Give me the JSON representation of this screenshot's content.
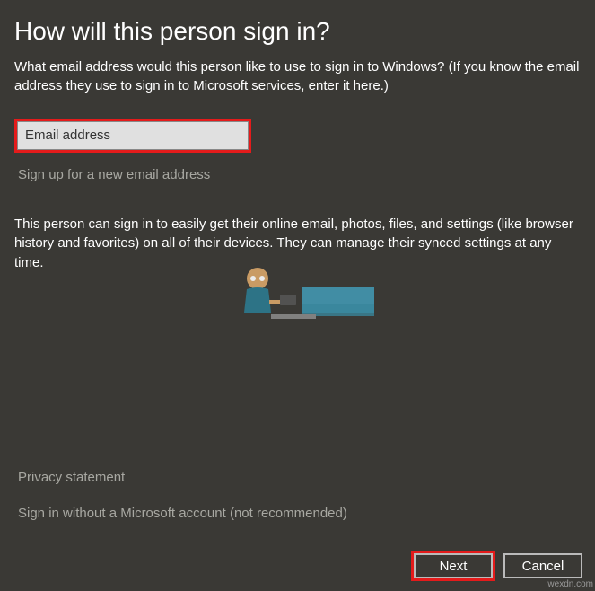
{
  "title": "How will this person sign in?",
  "subtitle": "What email address would this person like to use to sign in to Windows? (If you know the email address they use to sign in to Microsoft services, enter it here.)",
  "email_placeholder": "Email address",
  "signup_link": "Sign up for a new email address",
  "description": "This person can sign in to easily get their online email, photos, files, and settings (like browser history and favorites) on all of their devices. They can manage their synced settings at any time.",
  "privacy_link": "Privacy statement",
  "no_msaccount_link": "Sign in without a Microsoft account (not recommended)",
  "next_button": "Next",
  "cancel_button": "Cancel",
  "watermark": "wexdn.com"
}
